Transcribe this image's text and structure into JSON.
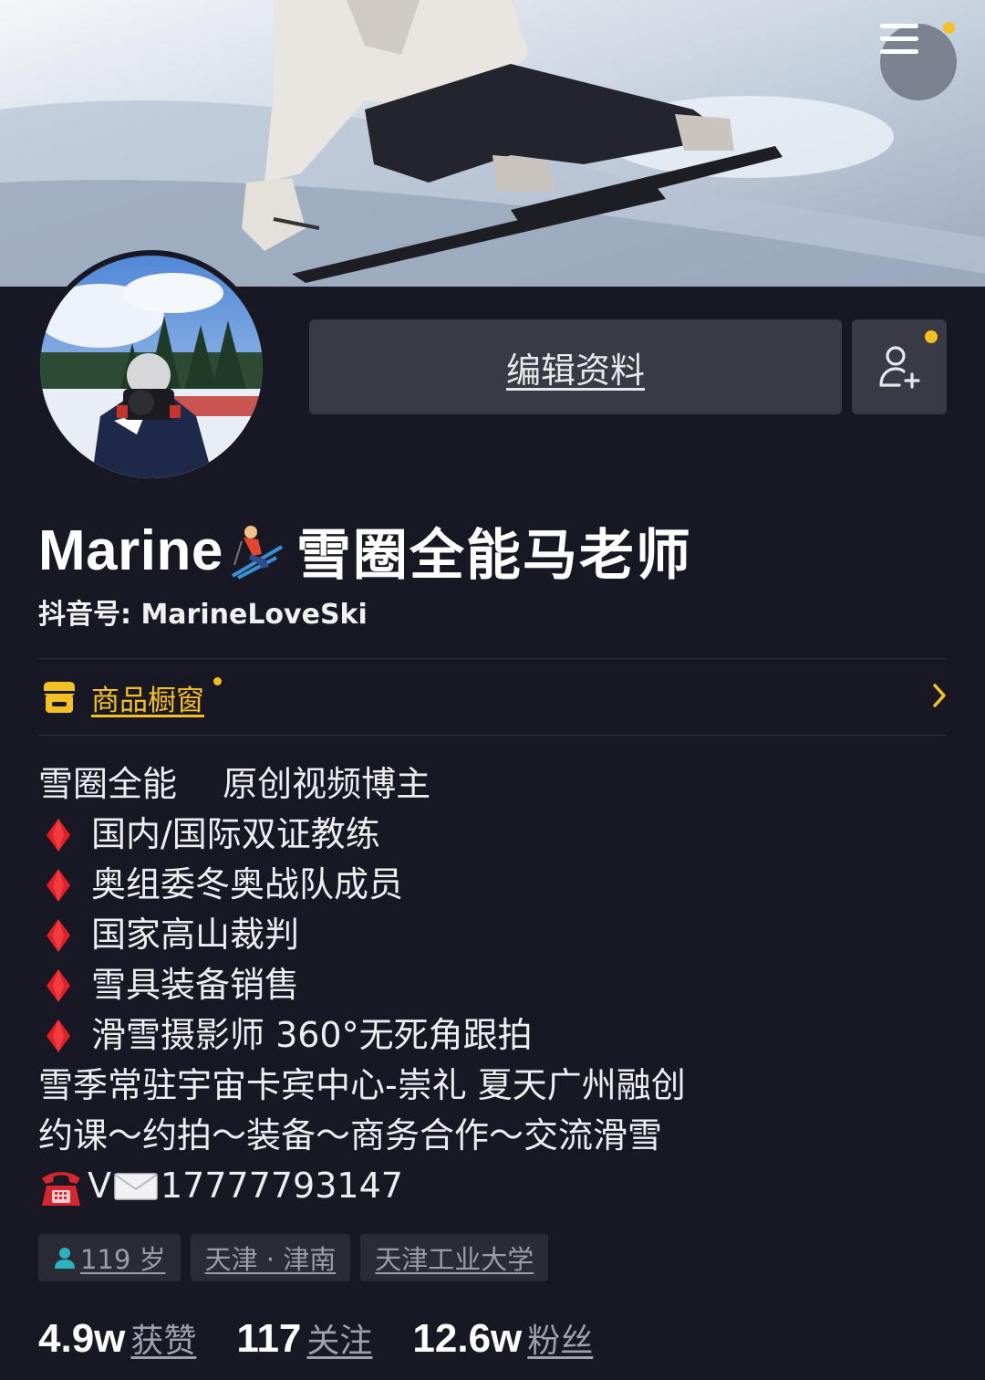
{
  "header": {
    "menu_icon": "hamburger-menu-icon",
    "notification_color": "#f5c024"
  },
  "profile": {
    "edit_button_label": "编辑资料",
    "add_friend_icon": "add-friend-icon",
    "name_en": "Marine",
    "name_emoji": "skier",
    "name_cn": "雪圈全能马老师",
    "douyin_id": "抖音号: MarineLoveSki"
  },
  "shop": {
    "label": "商品橱窗",
    "icon": "shop-icon",
    "accent_color": "#f5c024"
  },
  "bio": {
    "line1": "雪圈全能　 原创视频博主",
    "items": [
      "国内/国际双证教练",
      "奥组委冬奥战队成员",
      "国家高山裁判",
      "雪具装备销售",
      "滑雪摄影师 360°无死角跟拍"
    ],
    "line_location": "雪季常驻宇宙卡宾中心-崇礼 夏天广州融创",
    "line_services": "约课～约拍～装备～商务合作～交流滑雪",
    "contact_prefix": "V",
    "contact_number": "17777793147"
  },
  "tags": {
    "age": "119 岁",
    "location": "天津 · 津南",
    "school": "天津工业大学"
  },
  "stats": {
    "likes_num": "4.9w",
    "likes_label": "获赞",
    "following_num": "117",
    "following_label": "关注",
    "followers_num": "12.6w",
    "followers_label": "粉丝"
  }
}
